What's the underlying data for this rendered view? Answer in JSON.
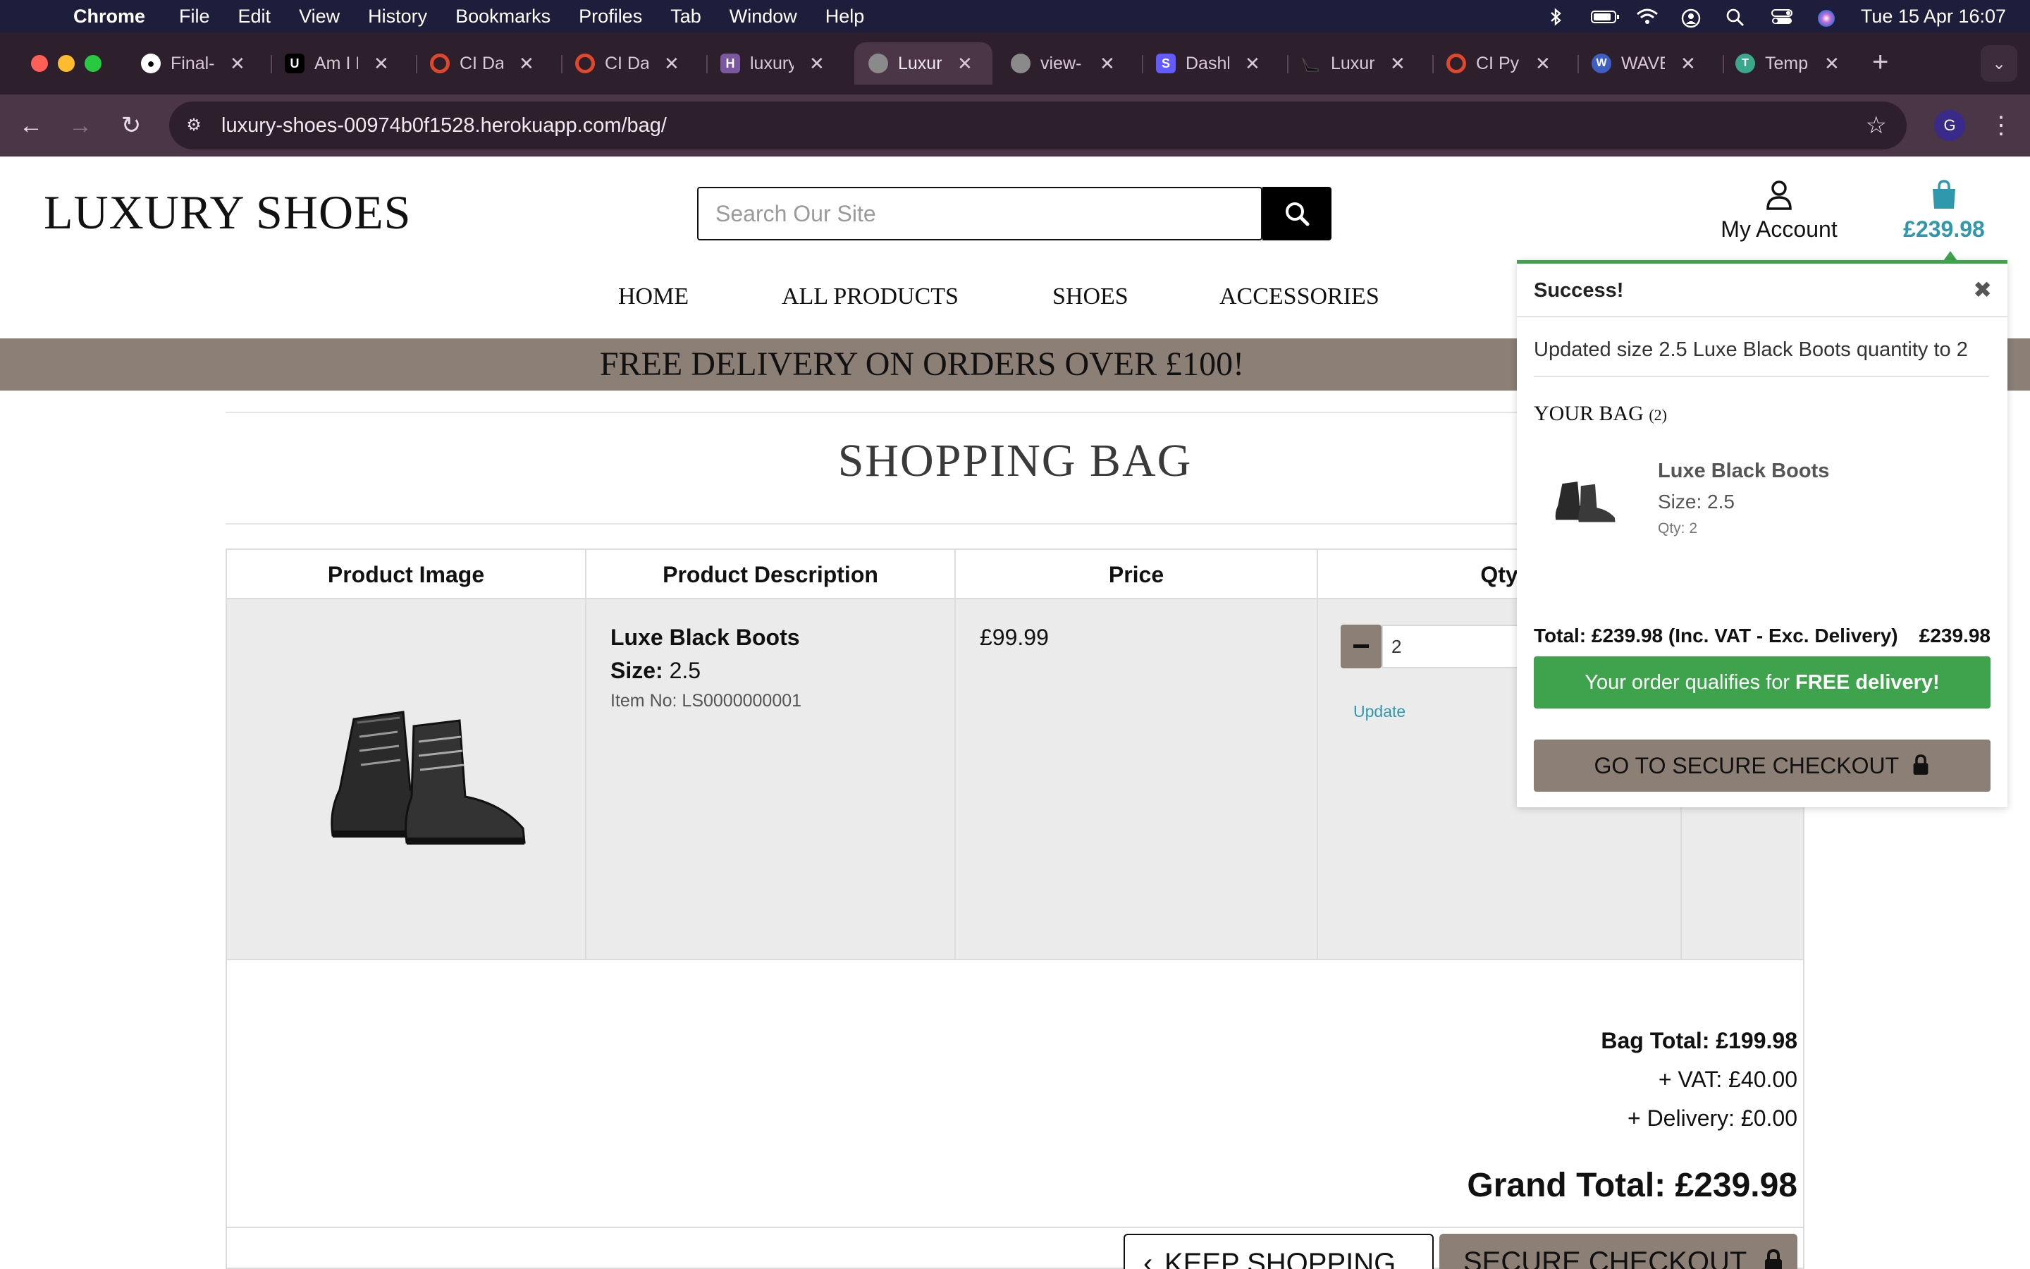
{
  "menubar": {
    "app_name": "Chrome",
    "items": [
      "File",
      "Edit",
      "View",
      "History",
      "Bookmarks",
      "Profiles",
      "Tab",
      "Window",
      "Help"
    ],
    "clock": "Tue 15 Apr  16:07"
  },
  "tabs": [
    {
      "label": "Final-",
      "favicon": "github-icon",
      "color": "#ffffff"
    },
    {
      "label": "Am I R",
      "favicon": "ui-icon",
      "color": "#000000"
    },
    {
      "label": "CI Da",
      "favicon": "ci-icon",
      "color": "#e0472b"
    },
    {
      "label": "CI Da",
      "favicon": "ci-icon",
      "color": "#e0472b"
    },
    {
      "label": "luxury",
      "favicon": "heroku-icon",
      "color": "#79589f"
    },
    {
      "label": "Luxur",
      "favicon": "globe-icon",
      "color": "#8a8a8a",
      "active": true
    },
    {
      "label": "view-",
      "favicon": "globe-icon",
      "color": "#8a8a8a"
    },
    {
      "label": "Dashb",
      "favicon": "stripe-icon",
      "color": "#635bff"
    },
    {
      "label": "Luxur",
      "favicon": "heel-icon",
      "color": "#000000"
    },
    {
      "label": "CI Py",
      "favicon": "ci-icon",
      "color": "#e0472b"
    },
    {
      "label": "WAVE",
      "favicon": "wave-icon",
      "color": "#3d5fc4"
    },
    {
      "label": "Temp",
      "favicon": "temp-icon",
      "color": "#39a98a"
    }
  ],
  "toolbar": {
    "url": "luxury-shoes-00974b0f1528.herokuapp.com/bag/",
    "profile_initial": "G"
  },
  "header": {
    "logo": "LUXURY SHOES",
    "search_placeholder": "Search Our Site",
    "account_label": "My Account",
    "bag_total": "£239.98"
  },
  "nav": [
    "HOME",
    "ALL PRODUCTS",
    "SHOES",
    "ACCESSORIES"
  ],
  "banner": "FREE DELIVERY ON ORDERS OVER £100!",
  "page": {
    "title": "SHOPPING BAG",
    "columns": [
      "Product Image",
      "Product Description",
      "Price",
      "Qty"
    ],
    "item": {
      "name": "Luxe Black Boots",
      "size_label": "Size:",
      "size": "2.5",
      "sku": "Item No: LS0000000001",
      "price": "£99.99",
      "qty": "2",
      "update_label": "Update"
    },
    "totals": {
      "bag_total": "Bag Total: £199.98",
      "vat": "+ VAT: £40.00",
      "delivery": "+ Delivery: £0.00",
      "grand_total": "Grand Total: £239.98"
    },
    "keep_shopping": "KEEP SHOPPING",
    "secure_checkout": "SECURE CHECKOUT"
  },
  "toast": {
    "title": "Success!",
    "message": "Updated size 2.5 Luxe Black Boots quantity to 2",
    "bag_heading": "YOUR BAG",
    "bag_count": "(2)",
    "item_name": "Luxe Black Boots",
    "item_size": "Size: 2.5",
    "item_qty": "Qty: 2",
    "total_label": "Total: £239.98 (Inc. VAT - Exc. Delivery)",
    "total_value": "£239.98",
    "free_delivery_prefix": "Your order qualifies for ",
    "free_delivery_bold": "FREE delivery!",
    "checkout_label": "GO TO SECURE CHECKOUT"
  },
  "colors": {
    "accent_taupe": "#8b7f76",
    "link_teal": "#2f98ad",
    "success_green": "#3fa34d"
  }
}
